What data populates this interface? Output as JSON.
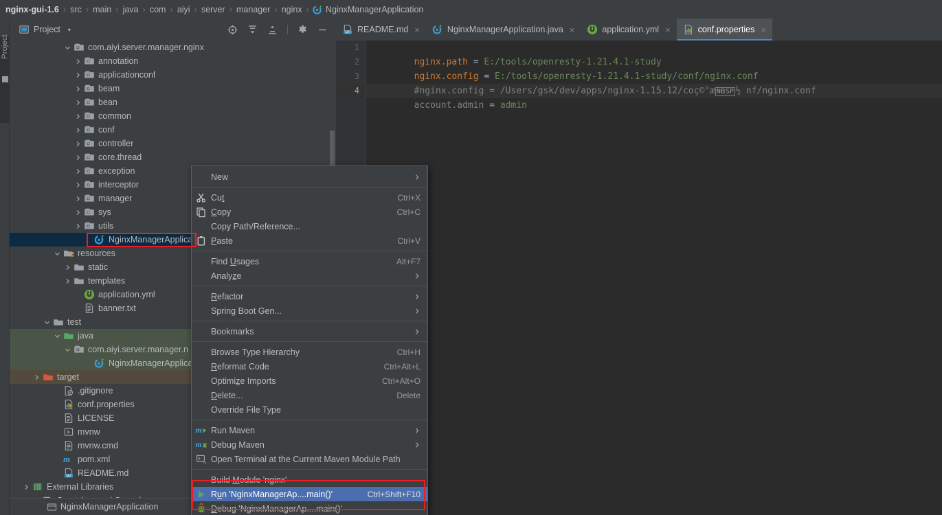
{
  "breadcrumb": {
    "items": [
      {
        "label": "nginx-gui-1.6",
        "icon": ""
      },
      {
        "label": "src",
        "icon": ""
      },
      {
        "label": "main",
        "icon": ""
      },
      {
        "label": "java",
        "icon": ""
      },
      {
        "label": "com",
        "icon": ""
      },
      {
        "label": "aiyi",
        "icon": ""
      },
      {
        "label": "server",
        "icon": ""
      },
      {
        "label": "manager",
        "icon": ""
      },
      {
        "label": "nginx",
        "icon": ""
      },
      {
        "label": "NginxManagerApplication",
        "icon": "spring-class-icon"
      }
    ],
    "separator": "›"
  },
  "tool_window": {
    "title": "Project",
    "dropdown_caret": "▾",
    "vertical_tab_label": "Project",
    "actions": [
      {
        "name": "select-opened-file-icon",
        "title": "Select Opened File"
      },
      {
        "name": "expand-all-icon",
        "title": "Expand All"
      },
      {
        "name": "collapse-all-icon",
        "title": "Collapse All"
      },
      {
        "name": "settings-gear-icon",
        "title": "Settings"
      },
      {
        "name": "hide-icon",
        "title": "Hide"
      }
    ]
  },
  "tree": {
    "rows": [
      {
        "label": "com.aiyi.server.manager.nginx",
        "indent": 5,
        "arrow": "down",
        "icon": "package-icon",
        "bg": "none"
      },
      {
        "label": "annotation",
        "indent": 6,
        "arrow": "right",
        "icon": "package-icon",
        "bg": "none"
      },
      {
        "label": "applicationconf",
        "indent": 6,
        "arrow": "right",
        "icon": "package-icon",
        "bg": "none"
      },
      {
        "label": "beam",
        "indent": 6,
        "arrow": "right",
        "icon": "package-icon",
        "bg": "none"
      },
      {
        "label": "bean",
        "indent": 6,
        "arrow": "right",
        "icon": "package-icon",
        "bg": "none"
      },
      {
        "label": "common",
        "indent": 6,
        "arrow": "right",
        "icon": "package-icon",
        "bg": "none"
      },
      {
        "label": "conf",
        "indent": 6,
        "arrow": "right",
        "icon": "package-icon",
        "bg": "none"
      },
      {
        "label": "controller",
        "indent": 6,
        "arrow": "right",
        "icon": "package-icon",
        "bg": "none"
      },
      {
        "label": "core.thread",
        "indent": 6,
        "arrow": "right",
        "icon": "package-icon",
        "bg": "none"
      },
      {
        "label": "exception",
        "indent": 6,
        "arrow": "right",
        "icon": "package-icon",
        "bg": "none"
      },
      {
        "label": "interceptor",
        "indent": 6,
        "arrow": "right",
        "icon": "package-icon",
        "bg": "none"
      },
      {
        "label": "manager",
        "indent": 6,
        "arrow": "right",
        "icon": "package-icon",
        "bg": "none"
      },
      {
        "label": "sys",
        "indent": 6,
        "arrow": "right",
        "icon": "package-icon",
        "bg": "none"
      },
      {
        "label": "utils",
        "indent": 6,
        "arrow": "right",
        "icon": "package-icon",
        "bg": "none"
      },
      {
        "label": "NginxManagerApplicat",
        "indent": 7,
        "arrow": "none",
        "icon": "spring-class-icon",
        "bg": "selected"
      },
      {
        "label": "resources",
        "indent": 4,
        "arrow": "down",
        "icon": "resources-folder-icon",
        "bg": "none"
      },
      {
        "label": "static",
        "indent": 5,
        "arrow": "right",
        "icon": "folder-icon",
        "bg": "none"
      },
      {
        "label": "templates",
        "indent": 5,
        "arrow": "right",
        "icon": "folder-icon",
        "bg": "none"
      },
      {
        "label": "application.yml",
        "indent": 6,
        "arrow": "none",
        "icon": "spring-yml-icon",
        "bg": "none"
      },
      {
        "label": "banner.txt",
        "indent": 6,
        "arrow": "none",
        "icon": "text-file-icon",
        "bg": "none"
      },
      {
        "label": "test",
        "indent": 3,
        "arrow": "down",
        "icon": "folder-icon",
        "bg": "none"
      },
      {
        "label": "java",
        "indent": 4,
        "arrow": "down",
        "icon": "source-root-icon",
        "bg": "green"
      },
      {
        "label": "com.aiyi.server.manager.n",
        "indent": 5,
        "arrow": "down",
        "icon": "package-icon",
        "bg": "green"
      },
      {
        "label": "NginxManagerApplicat",
        "indent": 7,
        "arrow": "none",
        "icon": "spring-class-icon",
        "bg": "green"
      },
      {
        "label": "target",
        "indent": 2,
        "arrow": "right",
        "icon": "target-folder-icon",
        "bg": "brown"
      },
      {
        "label": ".gitignore",
        "indent": 4,
        "arrow": "none",
        "icon": "gitignore-icon",
        "bg": "none"
      },
      {
        "label": "conf.properties",
        "indent": 4,
        "arrow": "none",
        "icon": "properties-icon",
        "bg": "none"
      },
      {
        "label": "LICENSE",
        "indent": 4,
        "arrow": "none",
        "icon": "text-file-icon",
        "bg": "none"
      },
      {
        "label": "mvnw",
        "indent": 4,
        "arrow": "none",
        "icon": "script-file-icon",
        "bg": "none"
      },
      {
        "label": "mvnw.cmd",
        "indent": 4,
        "arrow": "none",
        "icon": "text-file-icon",
        "bg": "none"
      },
      {
        "label": "pom.xml",
        "indent": 4,
        "arrow": "none",
        "icon": "maven-icon",
        "bg": "none"
      },
      {
        "label": "README.md",
        "indent": 4,
        "arrow": "none",
        "icon": "markdown-icon",
        "bg": "none"
      },
      {
        "label": "External Libraries",
        "indent": 1,
        "arrow": "right",
        "icon": "library-icon",
        "bg": "none"
      },
      {
        "label": "Scratches and Consoles",
        "indent": 2,
        "arrow": "none",
        "icon": "scratches-icon",
        "bg": "none"
      }
    ],
    "cut_off_row": "NginxManagerApplication"
  },
  "editor": {
    "tabs": [
      {
        "label": "README.md",
        "icon": "markdown-icon",
        "active": false,
        "close": "×"
      },
      {
        "label": "NginxManagerApplication.java",
        "icon": "spring-class-icon",
        "active": false,
        "close": "×"
      },
      {
        "label": "application.yml",
        "icon": "spring-yml-icon",
        "active": false,
        "close": "×"
      },
      {
        "label": "conf.properties",
        "icon": "properties-icon",
        "active": true,
        "close": "×"
      }
    ],
    "line_numbers": [
      "1",
      "2",
      "3",
      "4"
    ],
    "current_line": 4,
    "lines": [
      {
        "key": "nginx.path",
        "eq": " = ",
        "value": "E:/tools/openresty-1.21.4.1-study",
        "type": "prop"
      },
      {
        "key": "nginx.config",
        "eq": " = ",
        "value": "E:/tools/openresty-1.21.4.1-study/conf/nginx.conf",
        "type": "prop"
      },
      {
        "comment_a": "#nginx.config = /Users/gsk/dev/apps/nginx-1.15.12/coç©°æ",
        "nbsp": "NBSP",
        "comment_b": "½ nf/nginx.conf",
        "type": "comment"
      },
      {
        "key": "account.admin",
        "eq": " = ",
        "value": "admin",
        "type": "prop"
      }
    ]
  },
  "context_menu": {
    "items": [
      {
        "type": "item",
        "label": "New",
        "icon": "",
        "accel": "",
        "submenu": true,
        "mnemonic": "",
        "highlight": false
      },
      {
        "type": "sep"
      },
      {
        "type": "item",
        "label": "Cut",
        "icon": "cut-icon",
        "accel": "Ctrl+X",
        "submenu": false,
        "mnemonic": "t",
        "highlight": false
      },
      {
        "type": "item",
        "label": "Copy",
        "icon": "copy-icon",
        "accel": "Ctrl+C",
        "submenu": false,
        "mnemonic": "C",
        "highlight": false
      },
      {
        "type": "item",
        "label": "Copy Path/Reference...",
        "icon": "",
        "accel": "",
        "submenu": false,
        "mnemonic": "",
        "highlight": false
      },
      {
        "type": "item",
        "label": "Paste",
        "icon": "paste-icon",
        "accel": "Ctrl+V",
        "submenu": false,
        "mnemonic": "P",
        "highlight": false
      },
      {
        "type": "sep"
      },
      {
        "type": "item",
        "label": "Find Usages",
        "icon": "",
        "accel": "Alt+F7",
        "submenu": false,
        "mnemonic": "U",
        "highlight": false
      },
      {
        "type": "item",
        "label": "Analyze",
        "icon": "",
        "accel": "",
        "submenu": true,
        "mnemonic": "z",
        "highlight": false
      },
      {
        "type": "sep"
      },
      {
        "type": "item",
        "label": "Refactor",
        "icon": "",
        "accel": "",
        "submenu": true,
        "mnemonic": "R",
        "highlight": false
      },
      {
        "type": "item",
        "label": "Spring Boot Gen...",
        "icon": "",
        "accel": "",
        "submenu": true,
        "mnemonic": "",
        "highlight": false
      },
      {
        "type": "sep"
      },
      {
        "type": "item",
        "label": "Bookmarks",
        "icon": "",
        "accel": "",
        "submenu": true,
        "mnemonic": "",
        "highlight": false
      },
      {
        "type": "sep"
      },
      {
        "type": "item",
        "label": "Browse Type Hierarchy",
        "icon": "",
        "accel": "Ctrl+H",
        "submenu": false,
        "mnemonic": "",
        "highlight": false
      },
      {
        "type": "item",
        "label": "Reformat Code",
        "icon": "",
        "accel": "Ctrl+Alt+L",
        "submenu": false,
        "mnemonic": "R",
        "highlight": false
      },
      {
        "type": "item",
        "label": "Optimize Imports",
        "icon": "",
        "accel": "Ctrl+Alt+O",
        "submenu": false,
        "mnemonic": "z",
        "highlight": false
      },
      {
        "type": "item",
        "label": "Delete...",
        "icon": "",
        "accel": "Delete",
        "submenu": false,
        "mnemonic": "D",
        "highlight": false
      },
      {
        "type": "item",
        "label": "Override File Type",
        "icon": "",
        "accel": "",
        "submenu": false,
        "mnemonic": "",
        "highlight": false
      },
      {
        "type": "sep"
      },
      {
        "type": "item",
        "label": "Run Maven",
        "icon": "maven-run-icon",
        "accel": "",
        "submenu": true,
        "mnemonic": "",
        "highlight": false
      },
      {
        "type": "item",
        "label": "Debug Maven",
        "icon": "maven-debug-icon",
        "accel": "",
        "submenu": true,
        "mnemonic": "",
        "highlight": false
      },
      {
        "type": "item",
        "label": "Open Terminal at the Current Maven Module Path",
        "icon": "terminal-icon",
        "accel": "",
        "submenu": false,
        "mnemonic": "",
        "highlight": false
      },
      {
        "type": "sep"
      },
      {
        "type": "item",
        "label": "Build Module 'nginx'",
        "icon": "",
        "accel": "",
        "submenu": false,
        "mnemonic": "M",
        "highlight": false
      },
      {
        "type": "item",
        "label": "Run 'NginxManagerAp....main()'",
        "icon": "run-icon",
        "accel": "Ctrl+Shift+F10",
        "submenu": false,
        "mnemonic": "u",
        "highlight": true
      },
      {
        "type": "item",
        "label": "Debug 'NginxManagerAp....main()'",
        "icon": "debug-icon",
        "accel": "",
        "submenu": false,
        "mnemonic": "D",
        "highlight": false
      }
    ]
  },
  "colors": {
    "background": "#3c3f41",
    "editor_background": "#2b2b2b",
    "accent_blue": "#4b6eaf",
    "tab_underline": "#4a88c7",
    "selection_navy": "#0d2a43",
    "annotation_red": "#ee1c25",
    "text": "#bbbbbb",
    "string_green": "#6a8759",
    "key_orange": "#cc7832",
    "comment_gray": "#808080"
  }
}
